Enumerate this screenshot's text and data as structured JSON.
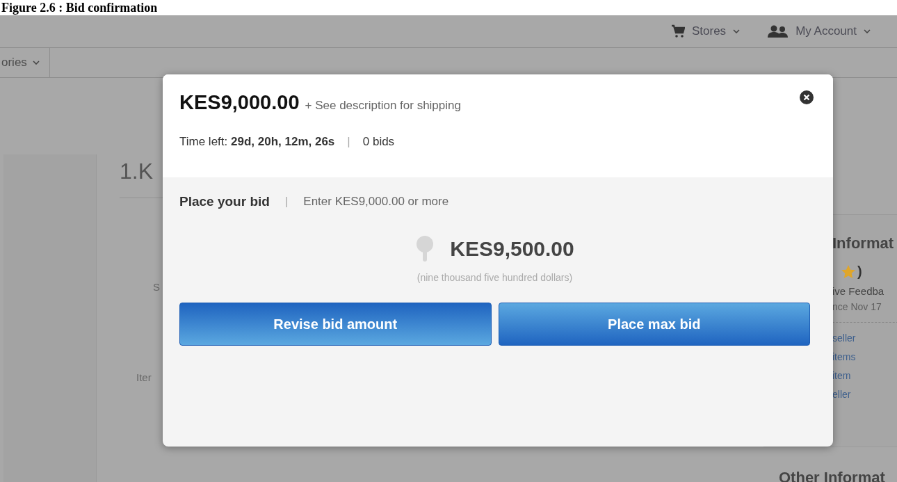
{
  "caption": "Figure 2.6 : Bid confirmation",
  "header": {
    "links": [
      {
        "label": "Stores",
        "kind": "cart"
      },
      {
        "label": "My Account",
        "kind": "people"
      }
    ]
  },
  "nav": {
    "label": "ories"
  },
  "background": {
    "title": "1.K",
    "labels": [
      "S",
      "Iter"
    ],
    "seller_panel": {
      "heading": "Informat",
      "rating": ")",
      "feedback": "ive Feedba",
      "since": "nce Nov 17",
      "links": [
        "seller",
        "items",
        "item",
        "eller"
      ]
    },
    "other_heading": "Other Informat"
  },
  "dialog": {
    "price": "KES9,000.00",
    "shipping": "+ See description for shipping",
    "time_text": "Time left: **29d, 20h, 12m, 26s**",
    "separators": [
      "|",
      "|"
    ],
    "bids": "0 bids",
    "bid_title": "Place your bid",
    "bid_hint": "Enter KES9,000.00 or more",
    "amount": "KES9,500.00",
    "amount_words": "(nine thousand five hundred dollars)",
    "buttons": [
      "Revise bid amount",
      "Place max bid"
    ]
  }
}
